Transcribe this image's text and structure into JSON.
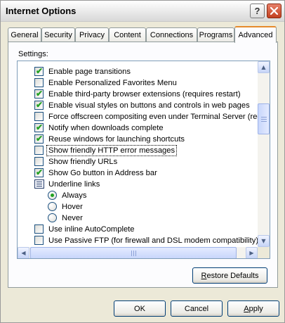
{
  "window": {
    "title": "Internet Options"
  },
  "titlebar": {
    "help_glyph": "?",
    "close_glyph": "✕"
  },
  "tabs": [
    {
      "label": "General"
    },
    {
      "label": "Security"
    },
    {
      "label": "Privacy"
    },
    {
      "label": "Content"
    },
    {
      "label": "Connections"
    },
    {
      "label": "Programs"
    },
    {
      "label": "Advanced",
      "active": true
    }
  ],
  "settings_label": "Settings:",
  "settings_items": [
    {
      "kind": "checkbox",
      "checked": true,
      "label": "Enable page transitions"
    },
    {
      "kind": "checkbox",
      "checked": false,
      "label": "Enable Personalized Favorites Menu"
    },
    {
      "kind": "checkbox",
      "checked": true,
      "label": "Enable third-party browser extensions (requires restart)"
    },
    {
      "kind": "checkbox",
      "checked": true,
      "label": "Enable visual styles on buttons and controls in web pages"
    },
    {
      "kind": "checkbox",
      "checked": false,
      "label": "Force offscreen compositing even under Terminal Server (requ"
    },
    {
      "kind": "checkbox",
      "checked": true,
      "label": "Notify when downloads complete"
    },
    {
      "kind": "checkbox",
      "checked": true,
      "label": "Reuse windows for launching shortcuts"
    },
    {
      "kind": "checkbox",
      "checked": false,
      "label": "Show friendly HTTP error messages",
      "focused": true
    },
    {
      "kind": "checkbox",
      "checked": false,
      "label": "Show friendly URLs"
    },
    {
      "kind": "checkbox",
      "checked": true,
      "label": "Show Go button in Address bar"
    },
    {
      "kind": "group",
      "label": "Underline links"
    },
    {
      "kind": "radio",
      "selected": true,
      "label": "Always"
    },
    {
      "kind": "radio",
      "selected": false,
      "label": "Hover"
    },
    {
      "kind": "radio",
      "selected": false,
      "label": "Never"
    },
    {
      "kind": "checkbox",
      "checked": false,
      "label": "Use inline AutoComplete"
    },
    {
      "kind": "checkbox",
      "checked": false,
      "label": "Use Passive FTP (for firewall and DSL modem compatibility)"
    }
  ],
  "scroll": {
    "up_glyph": "▲",
    "down_glyph": "▼",
    "left_glyph": "◀",
    "right_glyph": "▶"
  },
  "buttons": {
    "restore_defaults": {
      "mnemonic": "R",
      "rest": "estore Defaults"
    },
    "ok": "OK",
    "cancel": "Cancel",
    "apply": {
      "mnemonic": "A",
      "rest": "pply"
    }
  },
  "icons": {
    "help": "question-icon",
    "close": "close-icon",
    "check": "checkmark-icon",
    "group": "group-options-icon"
  },
  "colors": {
    "dialog_bg": "#ece9d8",
    "close_button": "#c2401f",
    "checkmark": "#21a121",
    "active_tab_accent": "#e68b2c",
    "list_border": "#7f9db9"
  }
}
